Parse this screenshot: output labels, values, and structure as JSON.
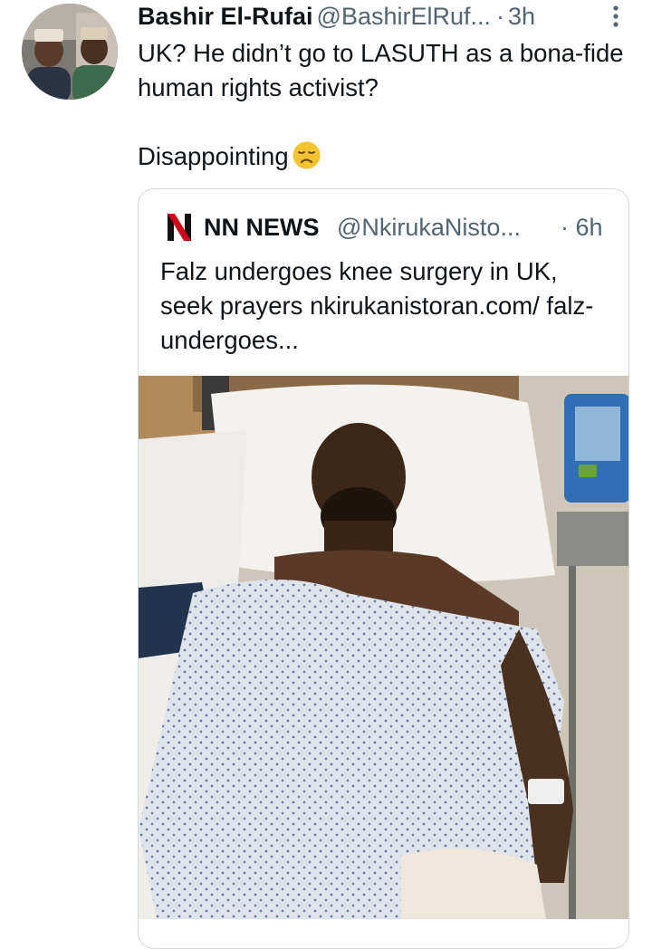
{
  "tweet": {
    "author_name": "Bashir El-Rufai",
    "author_handle": "@BashirElRuf...",
    "separator": "·",
    "time": "3h",
    "text_line1": "UK? He didn’t go to LASUTH as a bona-fide human rights activist?",
    "text_line2": "Disappointing",
    "emoji": "disappointed-face-emoji",
    "more_icon": "more-vertical-icon"
  },
  "quoted_tweet": {
    "source_logo": "nn-news-logo",
    "author_name": "NN NEWS",
    "author_handle": "@NkirukaNisto...",
    "time": "· 6h",
    "text": "Falz undergoes knee surgery in UK, seek prayers nkirukanistoran.com/ falz-undergoes...",
    "media": "photo-man-in-hospital-bed"
  },
  "colors": {
    "text_primary": "#0f1419",
    "text_secondary": "#536471",
    "border": "#cfd9de",
    "logo_red": "#d0021b",
    "emoji_yellow": "#f4c430"
  }
}
